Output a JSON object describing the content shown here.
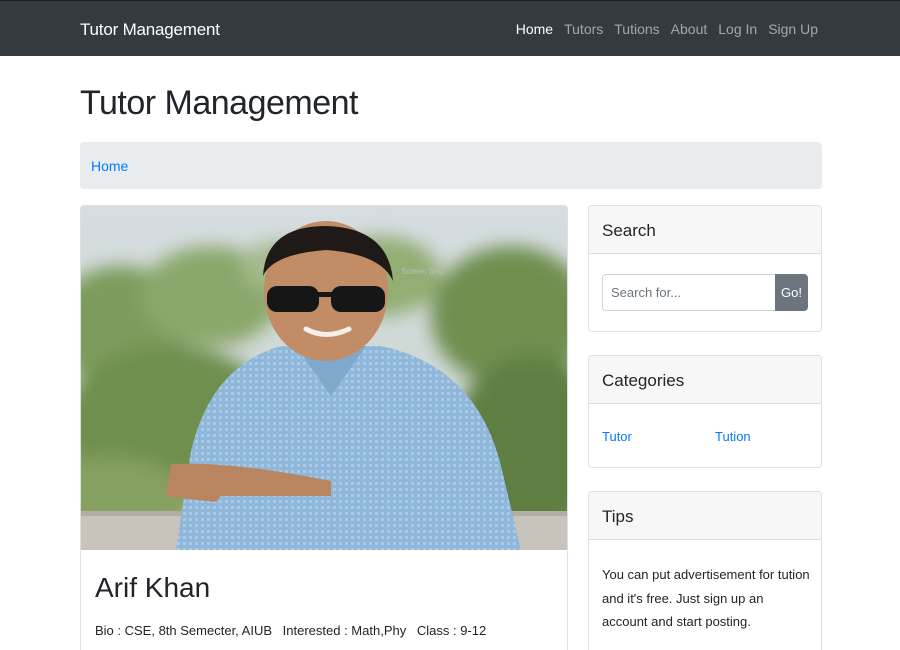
{
  "navbar": {
    "brand": "Tutor Management",
    "links": [
      {
        "label": "Home",
        "active": true
      },
      {
        "label": "Tutors",
        "active": false
      },
      {
        "label": "Tutions",
        "active": false
      },
      {
        "label": "About",
        "active": false
      },
      {
        "label": "Log In",
        "active": false
      },
      {
        "label": "Sign Up",
        "active": false
      }
    ]
  },
  "page_title": "Tutor Management",
  "breadcrumb": {
    "home": "Home"
  },
  "profile": {
    "name": "Arif Khan",
    "bio": "Bio : CSE, 8th Semecter, AIUB",
    "interested": "Interested : Math,Phy",
    "class": "Class : 9-12",
    "photo_watermark": "Screen Snip"
  },
  "sidebar": {
    "search": {
      "title": "Search",
      "placeholder": "Search for...",
      "button": "Go!"
    },
    "categories": {
      "title": "Categories",
      "items": [
        "Tutor",
        "Tution"
      ]
    },
    "tips": {
      "title": "Tips",
      "text": "You can put advertisement for tution and it's free. Just sign up an account and start posting."
    }
  },
  "colors": {
    "navbar_bg": "#343a40",
    "link": "#007bff",
    "button_bg": "#6c757d",
    "breadcrumb_bg": "#e9ecef"
  }
}
